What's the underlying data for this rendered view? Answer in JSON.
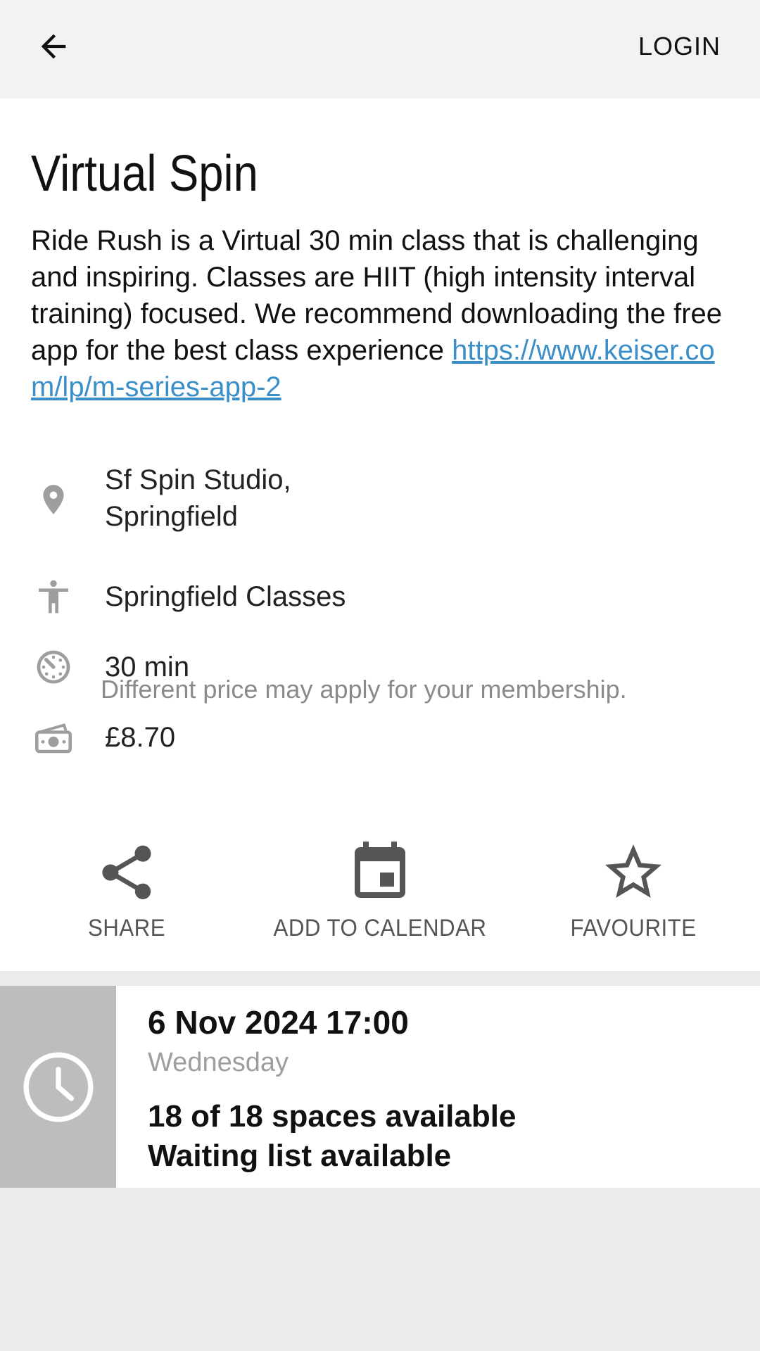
{
  "header": {
    "back_icon": "arrow-left-icon",
    "login_label": "LOGIN"
  },
  "class": {
    "title": "Virtual Spin",
    "description": "Ride Rush is a Virtual 30 min class that is challenging and inspiring. Classes are HIIT (high intensity interval training) focused. We recommend downloading the free app for the best class experience ",
    "link_text": "https://www.keiser.com/lp/m-series-app-2"
  },
  "details": {
    "location_line1": "Sf Spin Studio,",
    "location_line2": "Springfield",
    "category": "Springfield Classes",
    "duration": "30 min",
    "price": "£8.70",
    "price_note": "Different price may apply for your membership."
  },
  "actions": {
    "share": "SHARE",
    "calendar": "ADD TO CALENDAR",
    "favourite": "FAVOURITE"
  },
  "session": {
    "datetime": "6 Nov 2024 17:00",
    "weekday": "Wednesday",
    "spaces": "18 of 18 spaces available",
    "waiting": "Waiting list available"
  },
  "colors": {
    "link": "#3a8fc9",
    "icon_grey": "#9e9e9e",
    "action_grey": "#555555",
    "clock_box": "#bdbdbd"
  }
}
